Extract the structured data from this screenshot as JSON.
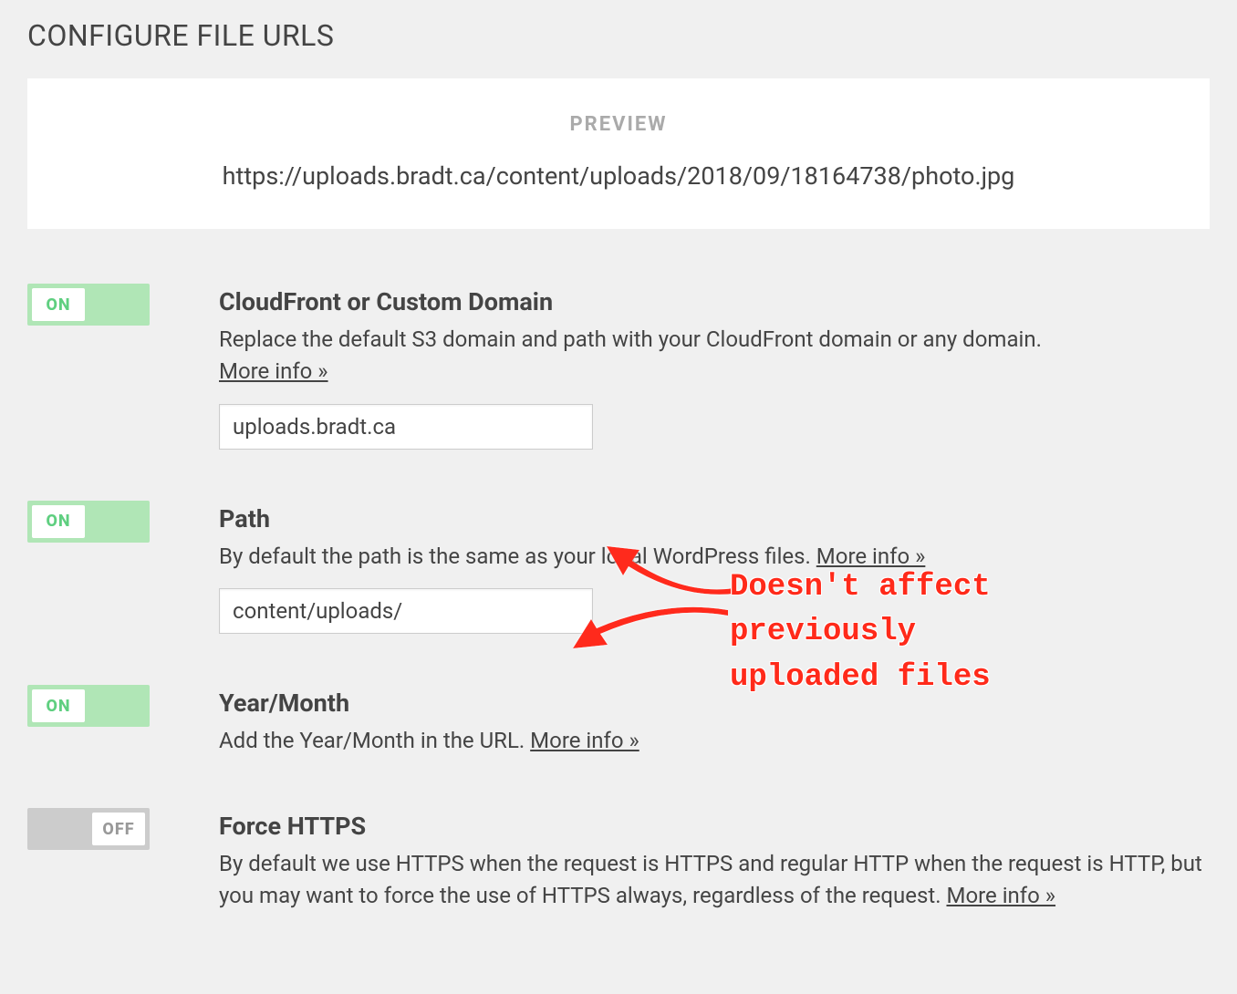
{
  "section_title": "CONFIGURE FILE URLS",
  "preview": {
    "label": "PREVIEW",
    "url": "https://uploads.bradt.ca/content/uploads/2018/09/18164738/photo.jpg"
  },
  "toggle_labels": {
    "on": "ON",
    "off": "OFF"
  },
  "more_info_label": "More info »",
  "settings": {
    "cloudfront": {
      "title": "CloudFront or Custom Domain",
      "desc": "Replace the default S3 domain and path with your CloudFront domain or any domain. ",
      "value": "uploads.bradt.ca",
      "on": true
    },
    "path": {
      "title": "Path",
      "desc": "By default the path is the same as your local WordPress files. ",
      "value": "content/uploads/",
      "on": true
    },
    "yearmonth": {
      "title": "Year/Month",
      "desc": "Add the Year/Month in the URL. ",
      "on": true
    },
    "https": {
      "title": "Force HTTPS",
      "desc": "By default we use HTTPS when the request is HTTPS and regular HTTP when the request is HTTP, but you may want to force the use of HTTPS always, regardless of the request. ",
      "on": false
    }
  },
  "annotation": {
    "text": "Doesn't affect\npreviously\nuploaded files"
  }
}
